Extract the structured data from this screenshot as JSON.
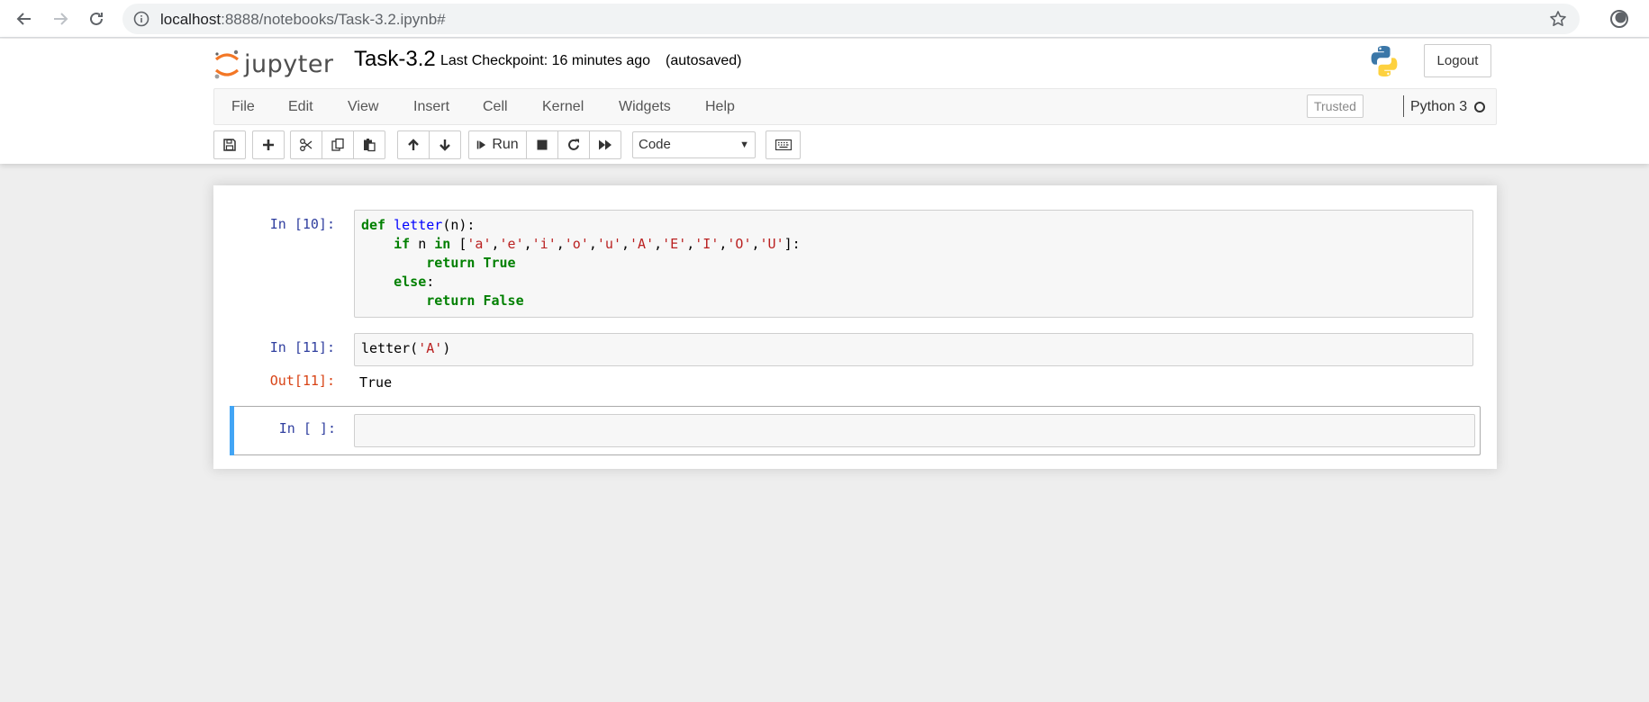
{
  "browser": {
    "url_host": "localhost",
    "url_path": ":8888/notebooks/Task-3.2.ipynb#"
  },
  "header": {
    "logo_text": "jupyter",
    "notebook_title": "Task-3.2",
    "checkpoint": "Last Checkpoint: 16 minutes ago",
    "autosaved": "(autosaved)",
    "logout_label": "Logout"
  },
  "menu": {
    "items": [
      "File",
      "Edit",
      "View",
      "Insert",
      "Cell",
      "Kernel",
      "Widgets",
      "Help"
    ],
    "trusted": "Trusted",
    "kernel_name": "Python 3"
  },
  "toolbar": {
    "run_label": "Run",
    "cell_type": "Code"
  },
  "cells": [
    {
      "prompt": "In [10]:",
      "code": "def letter(n):\n    if n in ['a','e','i','o','u','A','E','I','O','U']:\n        return True\n    else:\n        return False"
    },
    {
      "prompt": "In [11]:",
      "code": "letter('A')",
      "out_prompt": "Out[11]:",
      "output": "True"
    },
    {
      "prompt": "In [ ]:",
      "code": ""
    }
  ],
  "colors": {
    "in_prompt": "#303f9f",
    "out_prompt": "#d84315",
    "selected_bar": "#42a5f5",
    "keyword": "#008000",
    "string": "#ba2121",
    "function": "#0000ff"
  }
}
